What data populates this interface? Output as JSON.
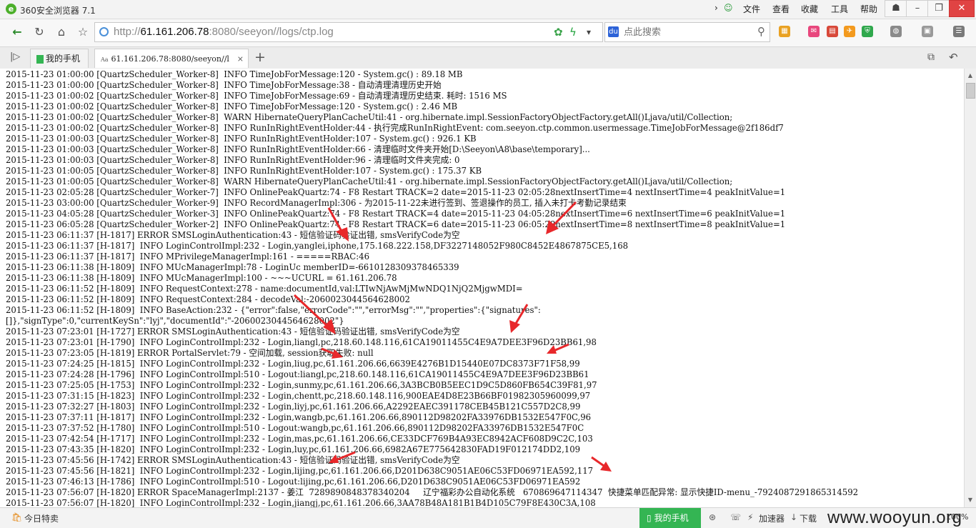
{
  "browser": {
    "title": "360安全浏览器 7.1",
    "menu": [
      "文件",
      "查看",
      "收藏",
      "工具",
      "帮助"
    ]
  },
  "address": {
    "scheme": "http://",
    "host": "61.161.206.78",
    "path": ":8080/seeyon//logs/ctp.log"
  },
  "search": {
    "placeholder": "点此搜索"
  },
  "tabs": [
    {
      "label": "我的手机"
    },
    {
      "label": "61.161.206.78:8080/seeyon//l"
    }
  ],
  "log_lines": [
    "2015-11-23 01:00:00 [QuartzScheduler_Worker-8]  INFO TimeJobForMessage:120 - System.gc() : 89.18 MB",
    "2015-11-23 01:00:00 [QuartzScheduler_Worker-8]  INFO TimeJobForMessage:38 - 自动清理清理历史开始",
    "2015-11-23 01:00:02 [QuartzScheduler_Worker-8]  INFO TimeJobForMessage:69 - 自动清理清理历史结束. 耗时: 1516 MS",
    "2015-11-23 01:00:02 [QuartzScheduler_Worker-8]  INFO TimeJobForMessage:120 - System.gc() : 2.46 MB",
    "2015-11-23 01:00:02 [QuartzScheduler_Worker-8]  WARN HibernateQueryPlanCacheUtil:41 - org.hibernate.impl.SessionFactoryObjectFactory.getAll()Ljava/util/Collection;",
    "2015-11-23 01:00:02 [QuartzScheduler_Worker-8]  INFO RunInRightEventHolder:44 - 执行完成RunInRightEvent: com.seeyon.ctp.common.usermessage.TimeJobForMessage@2f186df7",
    "2015-11-23 01:00:03 [QuartzScheduler_Worker-8]  INFO RunInRightEventHolder:107 - System.gc() : 926.1 KB",
    "2015-11-23 01:00:03 [QuartzScheduler_Worker-8]  INFO RunInRightEventHolder:66 - 清理临时文件夹开始[D:\\Seeyon\\A8\\base\\temporary]...",
    "2015-11-23 01:00:03 [QuartzScheduler_Worker-8]  INFO RunInRightEventHolder:96 - 清理临时文件夹完成: 0",
    "2015-11-23 01:00:05 [QuartzScheduler_Worker-8]  INFO RunInRightEventHolder:107 - System.gc() : 175.37 KB",
    "2015-11-23 01:00:05 [QuartzScheduler_Worker-8]  WARN HibernateQueryPlanCacheUtil:41 - org.hibernate.impl.SessionFactoryObjectFactory.getAll()Ljava/util/Collection;",
    "2015-11-23 02:05:28 [QuartzScheduler_Worker-7]  INFO OnlinePeakQuartz:74 - F8 Restart TRACK=2 date=2015-11-23 02:05:28nextInsertTime=4 nextInsertTime=4 peakInitValue=1",
    "2015-11-23 03:00:00 [QuartzScheduler_Worker-9]  INFO RecordManagerImpl:306 - 为2015-11-22未进行签到、签退操作的员工, 插入未打卡考勤记录结束",
    "2015-11-23 04:05:28 [QuartzScheduler_Worker-3]  INFO OnlinePeakQuartz:74 - F8 Restart TRACK=4 date=2015-11-23 04:05:28nextInsertTime=6 nextInsertTime=6 peakInitValue=1",
    "2015-11-23 06:05:28 [QuartzScheduler_Worker-2]  INFO OnlinePeakQuartz:74 - F8 Restart TRACK=6 date=2015-11-23 06:05:28nextInsertTime=8 nextInsertTime=8 peakInitValue=1",
    "2015-11-23 06:11:37 [H-1817] ERROR SMSLoginAuthentication:43 - 短信验证码验证出错, smsVerifyCode为空",
    "2015-11-23 06:11:37 [H-1817]  INFO LoginControlImpl:232 - Login,yanglei,iphone,175.168.222.158,DF3227148052F980C8452E4867875CE5,168",
    "2015-11-23 06:11:37 [H-1817]  INFO MPrivilegeManagerImpl:161 - =====RBAC:46",
    "2015-11-23 06:11:38 [H-1809]  INFO MUcManagerImpl:78 - LoginUc memberID=-6610128309378465339",
    "2015-11-23 06:11:38 [H-1809]  INFO MUcManagerImpl:100 - ~~~UCURL = 61.161.206.78",
    "2015-11-23 06:11:52 [H-1809]  INFO RequestContext:278 - name:documentId,val:LTIwNjAwMjMwNDQ1NjQ2MjgwMDI=",
    "2015-11-23 06:11:52 [H-1809]  INFO RequestContext:284 - decodeVal:-2060023044564628002",
    "2015-11-23 06:11:52 [H-1809]  INFO BaseAction:232 - {\"error\":false,\"errorCode\":\"\",\"errorMsg\":\"\",\"properties\":{\"signatures\":",
    "[]},\"signType\":0,\"currentKeySn\":\"lyj\",\"documentId\":\"-2060023044564628002\"}",
    "2015-11-23 07:23:01 [H-1727] ERROR SMSLoginAuthentication:43 - 短信验证码验证出错, smsVerifyCode为空",
    "2015-11-23 07:23:01 [H-1790]  INFO LoginControlImpl:232 - Login,liangl,pc,218.60.148.116,61CA19011455C4E9A7DEE3F96D23BB61,98",
    "2015-11-23 07:23:05 [H-1819] ERROR PortalServlet:79 - 空间加载, session获取失败: null",
    "2015-11-23 07:24:25 [H-1815]  INFO LoginControlImpl:232 - Login,liug,pc,61.161.206.66,6639E4276B1D15440E07DC8373F71F58,99",
    "2015-11-23 07:24:28 [H-1796]  INFO LoginControlImpl:510 - Logout:liangl,pc,218.60.148.116,61CA19011455C4E9A7DEE3F96D23BB61",
    "2015-11-23 07:25:05 [H-1753]  INFO LoginControlImpl:232 - Login,sunmy,pc,61.161.206.66,3A3BCB0B5EEC1D9C5D860FB654C39F81,97",
    "2015-11-23 07:31:15 [H-1823]  INFO LoginControlImpl:232 - Login,chentt,pc,218.60.148.116,900EAE4D8E23B66BF01982305960099,97",
    "2015-11-23 07:32:27 [H-1803]  INFO LoginControlImpl:232 - Login,liyj,pc,61.161.206.66,A2292EAEC391178CEB45B121C557D2C8,99",
    "2015-11-23 07:37:11 [H-1817]  INFO LoginControlImpl:232 - Login,wangb,pc,61.161.206.66,890112D98202FA33976DB1532E547F0C,96",
    "2015-11-23 07:37:52 [H-1780]  INFO LoginControlImpl:510 - Logout:wangb,pc,61.161.206.66,890112D98202FA33976DB1532E547F0C",
    "2015-11-23 07:42:54 [H-1717]  INFO LoginControlImpl:232 - Login,mas,pc,61.161.206.66,CE33DCF769B4A93EC8942ACF608D9C2C,103",
    "2015-11-23 07:43:35 [H-1820]  INFO LoginControlImpl:232 - Login,luy,pc,61.161.206.66,6982A67E775642830FAD19F012174DD2,109",
    "2015-11-23 07:45:56 [H-1742] ERROR SMSLoginAuthentication:43 - 短信验证码验证出错, smsVerifyCode为空",
    "2015-11-23 07:45:56 [H-1821]  INFO LoginControlImpl:232 - Login,lijing,pc,61.161.206.66,D201D638C9051AE06C53FD06971EA592,117",
    "2015-11-23 07:46:13 [H-1786]  INFO LoginControlImpl:510 - Logout:lijing,pc,61.161.206.66,D201D638C9051AE06C53FD06971EA592",
    "2015-11-23 07:56:07 [H-1820] ERROR SpaceManagerImpl:2137 - 姜江  7289890848378340204     辽宁福彩办公自动化系统   670869647114347  快捷菜单匹配异常: 显示快捷ID-menu_-7924087291865314592",
    "2015-11-23 07:56:07 [H-1820]  INFO LoginControlImpl:232 - Login,jiangj,pc,61.161.206.66,3AA78B48A181B1B4D105C79F8E430C3A,108"
  ],
  "status": {
    "deals": "今日特卖",
    "phone": "我的手机",
    "accelerator": "加速器",
    "download": "下载",
    "zoom": "100%",
    "watermark": "www.wooyun.org"
  },
  "colors": {
    "annotation_arrow": "#e8282b",
    "phone_green": "#34b553"
  }
}
